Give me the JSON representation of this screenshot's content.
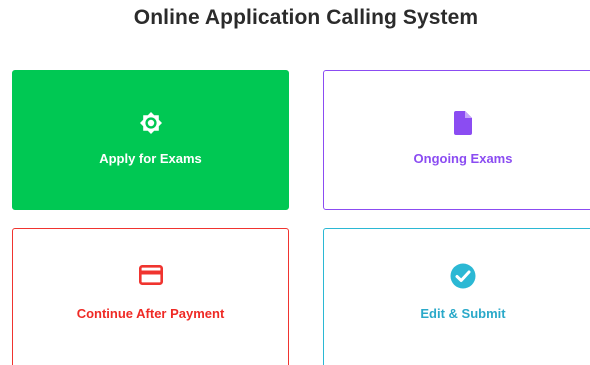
{
  "page": {
    "title": "Online Application Calling System"
  },
  "cards": [
    {
      "label": "Apply for Exams",
      "icon": "gear-icon",
      "color": "#00c853"
    },
    {
      "label": "Ongoing Exams",
      "icon": "document-icon",
      "color": "#8b4cf2"
    },
    {
      "label": "Continue After Payment",
      "icon": "credit-card-icon",
      "color": "#f0342f"
    },
    {
      "label": "Edit & Submit",
      "icon": "check-circle-icon",
      "color": "#2bb8d4"
    }
  ]
}
